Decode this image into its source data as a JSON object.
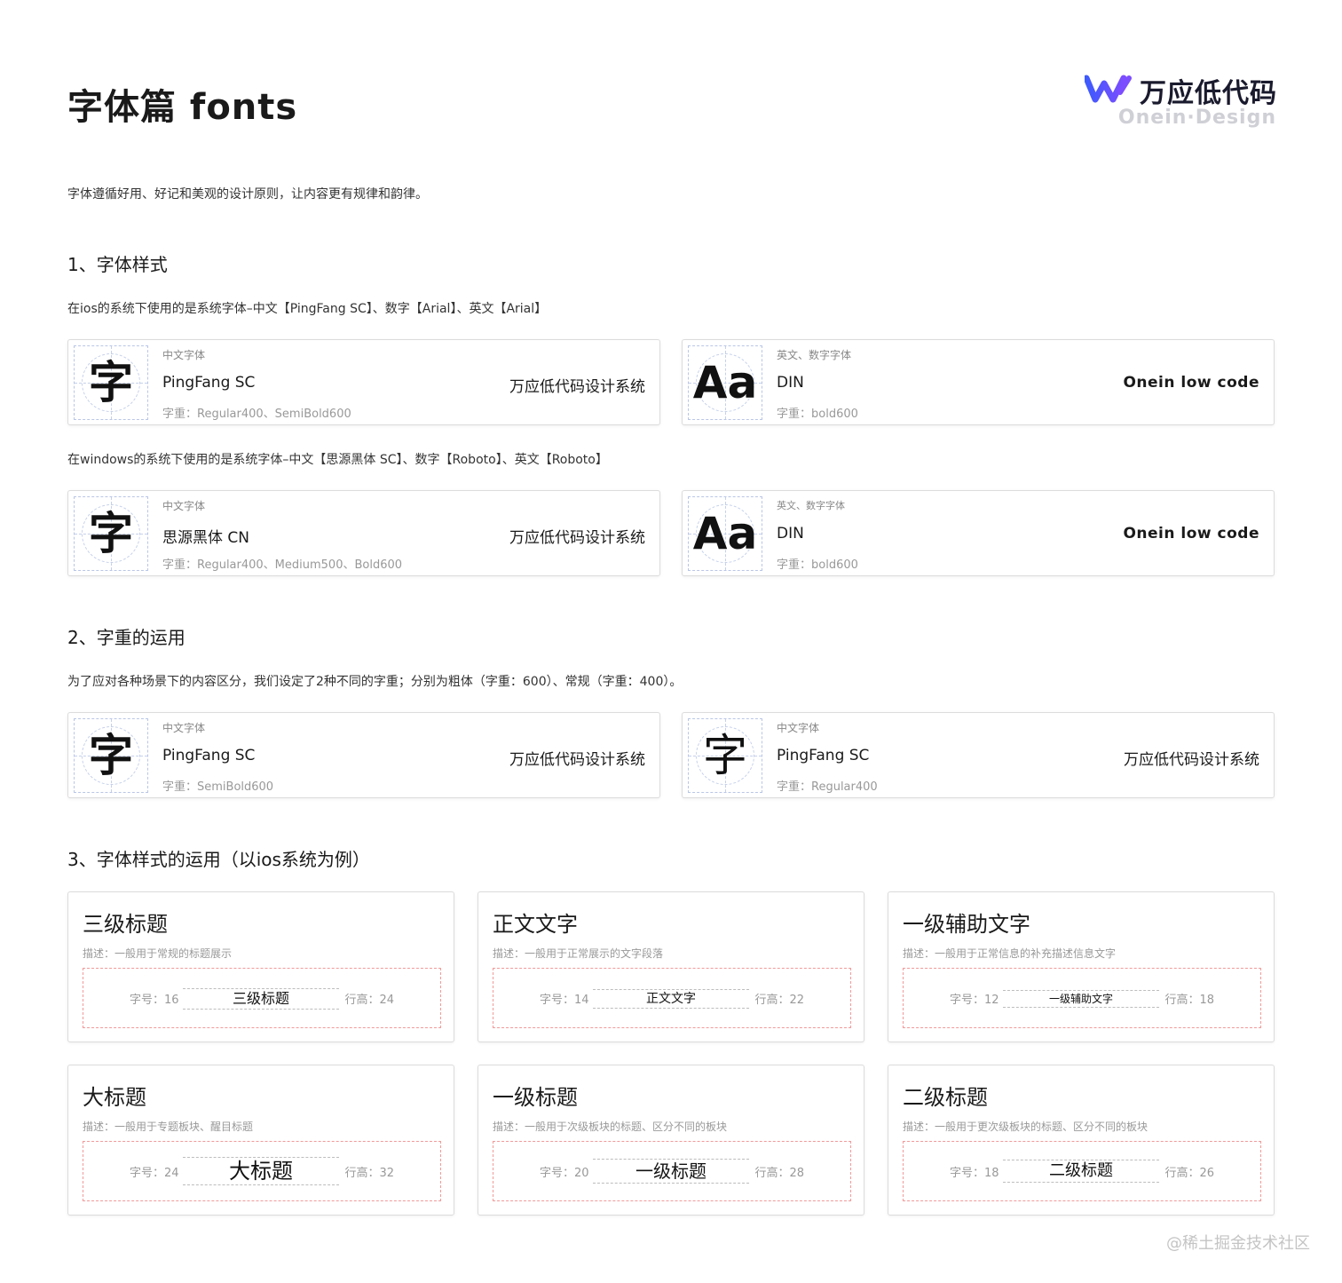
{
  "header": {
    "title": "字体篇 fonts",
    "logo_name": "万应低代码",
    "logo_sub": "Onein·Design",
    "brand_colors": [
      "#3d5afe",
      "#7c4dff"
    ]
  },
  "intro": "字体遵循好用、好记和美观的设计原则，让内容更有规律和韵律。",
  "section1": {
    "heading": "1、字体样式",
    "ios_desc": "在ios的系统下使用的是系统字体–中文【PingFang SC】、数字【Arial】、英文【Arial】",
    "windows_desc": "在windows的系统下使用的是系统字体–中文【思源黑体 SC】、数字【Roboto】、英文【Roboto】",
    "cards": [
      {
        "glyph": "字",
        "category": "中文字体",
        "font": "PingFang SC",
        "weight": "字重：Regular400、SemiBold600",
        "sample": "万应低代码设计系统"
      },
      {
        "glyph": "Aa",
        "category": "英文、数字字体",
        "font": "DIN",
        "weight": "字重：bold600",
        "sample": "Onein low code"
      },
      {
        "glyph": "字",
        "category": "中文字体",
        "font": "思源黑体 CN",
        "weight": "字重：Regular400、Medium500、Bold600",
        "sample": "万应低代码设计系统"
      },
      {
        "glyph": "Aa",
        "category": "英文、数字字体",
        "font": "DIN",
        "weight": "字重：bold600",
        "sample": "Onein low code"
      }
    ]
  },
  "section2": {
    "heading": "2、字重的运用",
    "desc": "为了应对各种场景下的内容区分，我们设定了2种不同的字重；分别为粗体（字重：600）、常规（字重：400）。",
    "cards": [
      {
        "glyph": "字",
        "category": "中文字体",
        "font": "PingFang SC",
        "weight": "字重：SemiBold600",
        "sample": "万应低代码设计系统"
      },
      {
        "glyph": "字",
        "category": "中文字体",
        "font": "PingFang SC",
        "weight": "字重：Regular400",
        "sample": "万应低代码设计系统"
      }
    ]
  },
  "section3": {
    "heading": "3、字体样式的运用（以ios系统为例）",
    "cards": [
      {
        "title": "三级标题",
        "desc": "描述：一般用于常规的标题展示",
        "size_label": "字号：16",
        "demo": "三级标题",
        "lh_label": "行高：24",
        "font_size": 16,
        "line_height": 24
      },
      {
        "title": "正文文字",
        "desc": "描述：一般用于正常展示的文字段落",
        "size_label": "字号：14",
        "demo": "正文文字",
        "lh_label": "行高：22",
        "font_size": 14,
        "line_height": 22
      },
      {
        "title": "一级辅助文字",
        "desc": "描述：一般用于正常信息的补充描述信息文字",
        "size_label": "字号：12",
        "demo": "一级辅助文字",
        "lh_label": "行高：18",
        "font_size": 12,
        "line_height": 18
      },
      {
        "title": "大标题",
        "desc": "描述：一般用于专题板块、醒目标题",
        "size_label": "字号：24",
        "demo": "大标题",
        "lh_label": "行高：32",
        "font_size": 24,
        "line_height": 32
      },
      {
        "title": "一级标题",
        "desc": "描述：一般用于次级板块的标题、区分不同的板块",
        "size_label": "字号：20",
        "demo": "一级标题",
        "lh_label": "行高：28",
        "font_size": 20,
        "line_height": 28
      },
      {
        "title": "二级标题",
        "desc": "描述：一般用于更次级板块的标题、区分不同的板块",
        "size_label": "字号：18",
        "demo": "二级标题",
        "lh_label": "行高：26",
        "font_size": 18,
        "line_height": 26
      }
    ]
  },
  "watermark": "@稀土掘金技术社区"
}
